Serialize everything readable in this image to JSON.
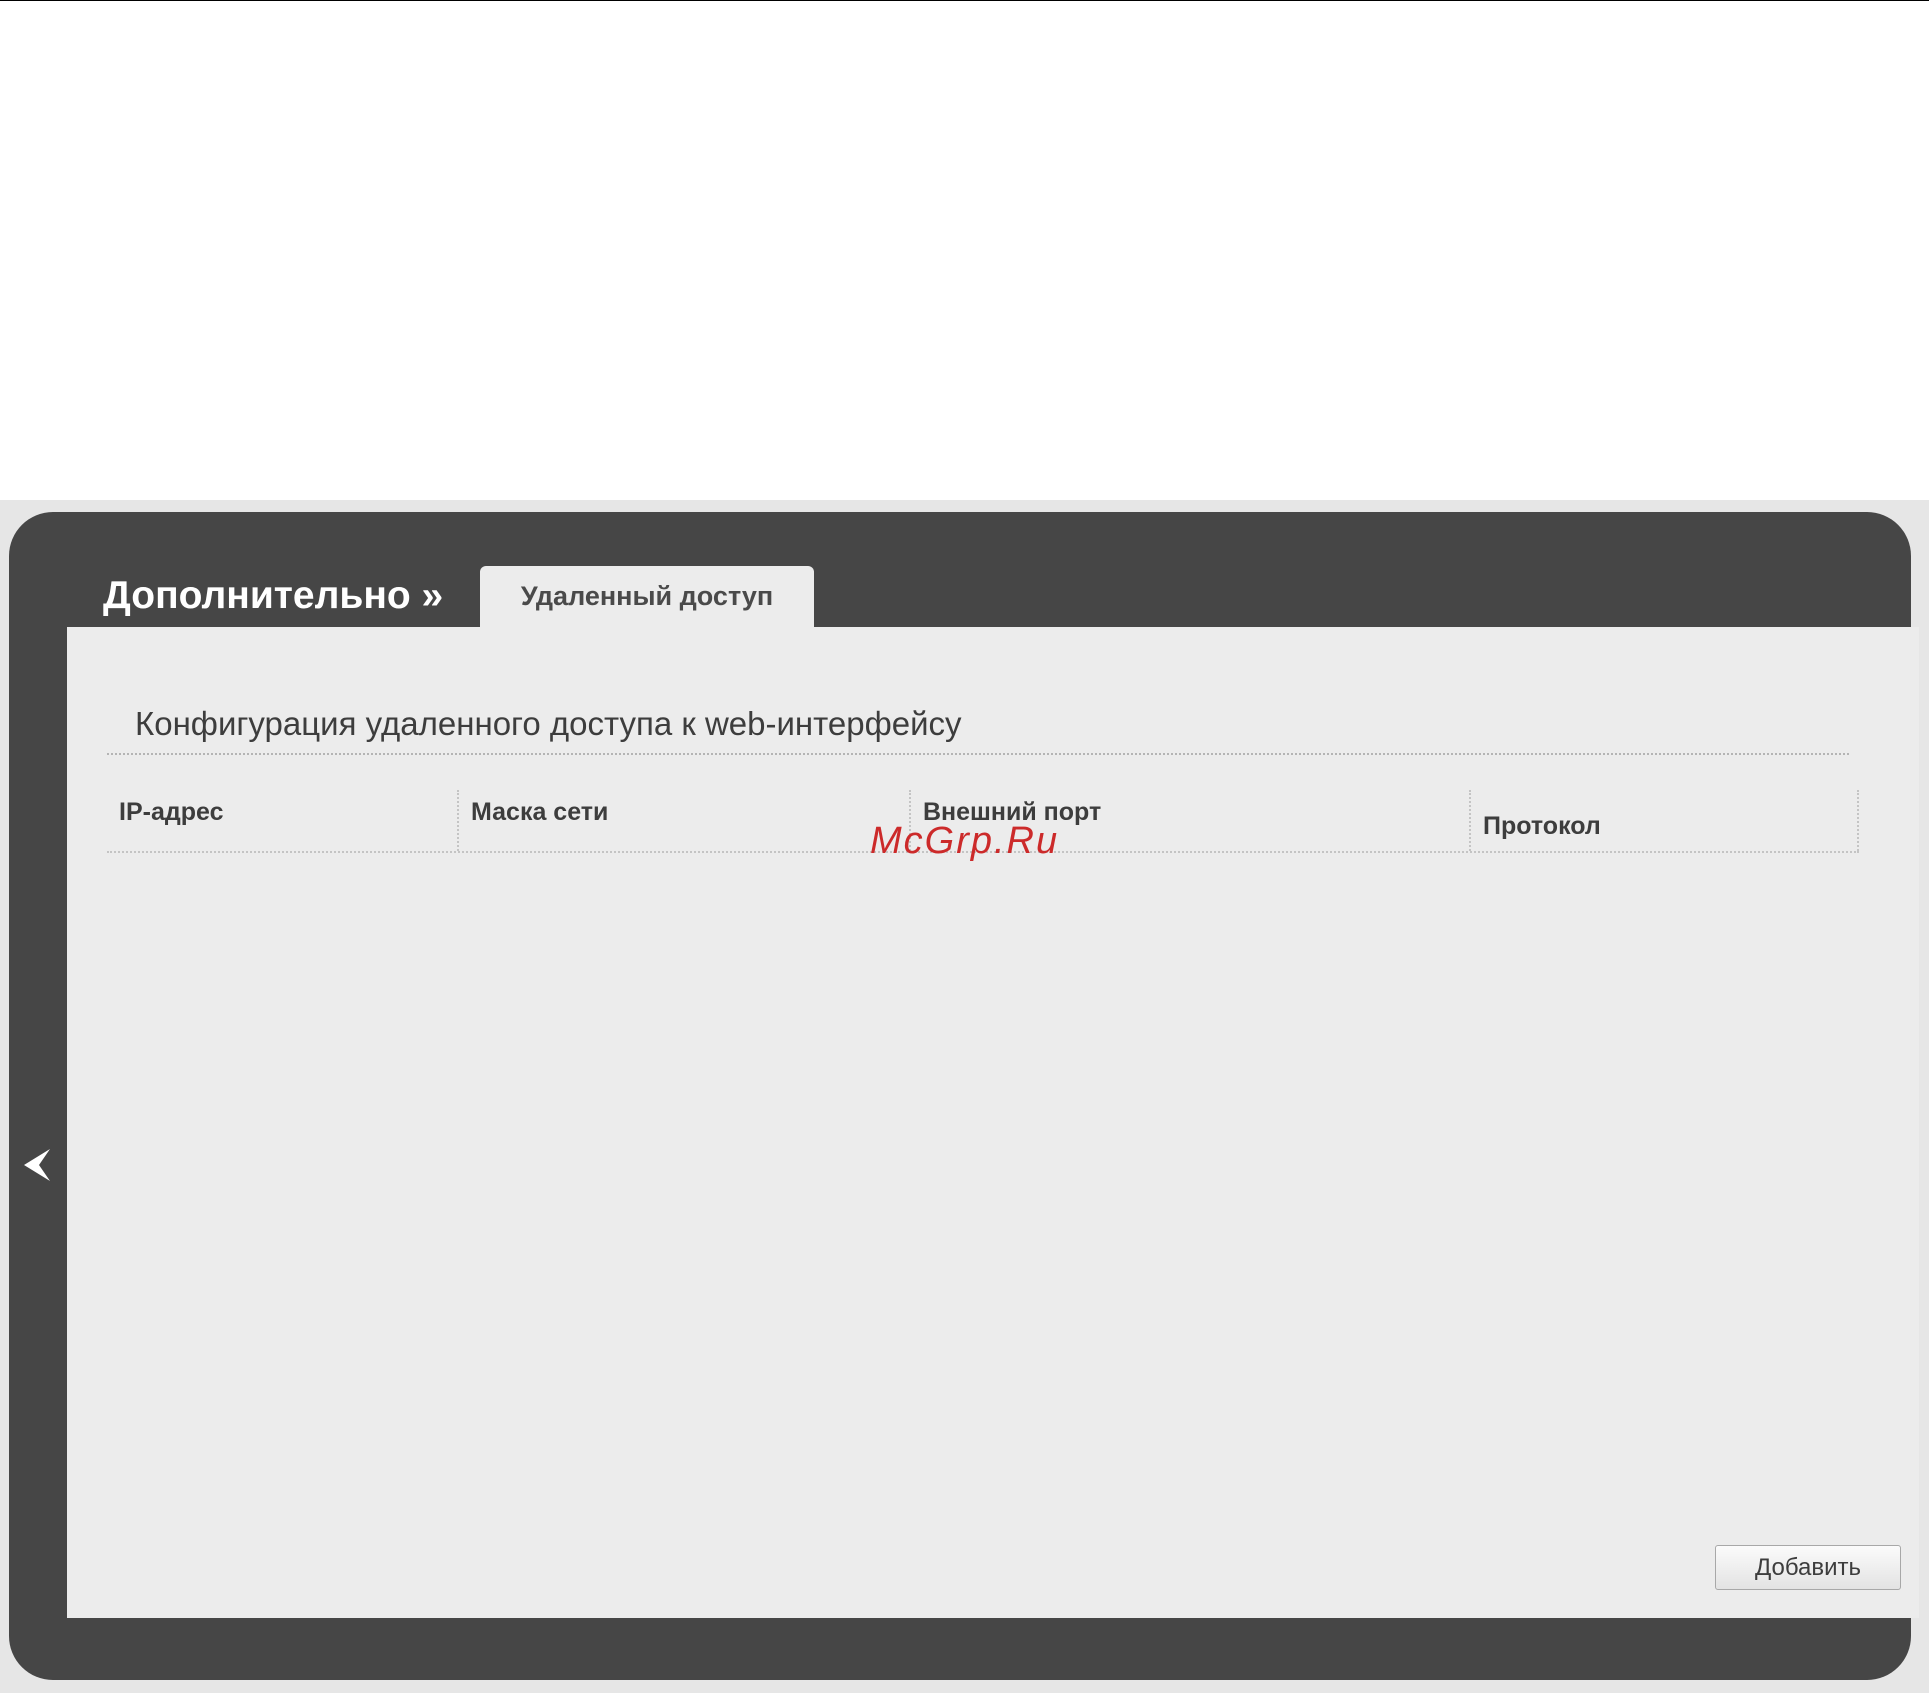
{
  "header": {
    "section_title": "Дополнительно »",
    "active_tab": "Удаленный доступ"
  },
  "panel": {
    "heading": "Конфигурация удаленного доступа к web-интерфейсу"
  },
  "table": {
    "columns": [
      "IP-адрес",
      "Маска сети",
      "Внешний порт",
      "Протокол"
    ],
    "rows": []
  },
  "actions": {
    "add_label": "Добавить"
  },
  "watermark": {
    "text": "McGrp.Ru"
  },
  "icons": {
    "sidebar_toggle": "chevron-left-icon"
  },
  "colors": {
    "frame": "#464646",
    "panel": "#ececec",
    "watermark": "#cc2a2a"
  }
}
